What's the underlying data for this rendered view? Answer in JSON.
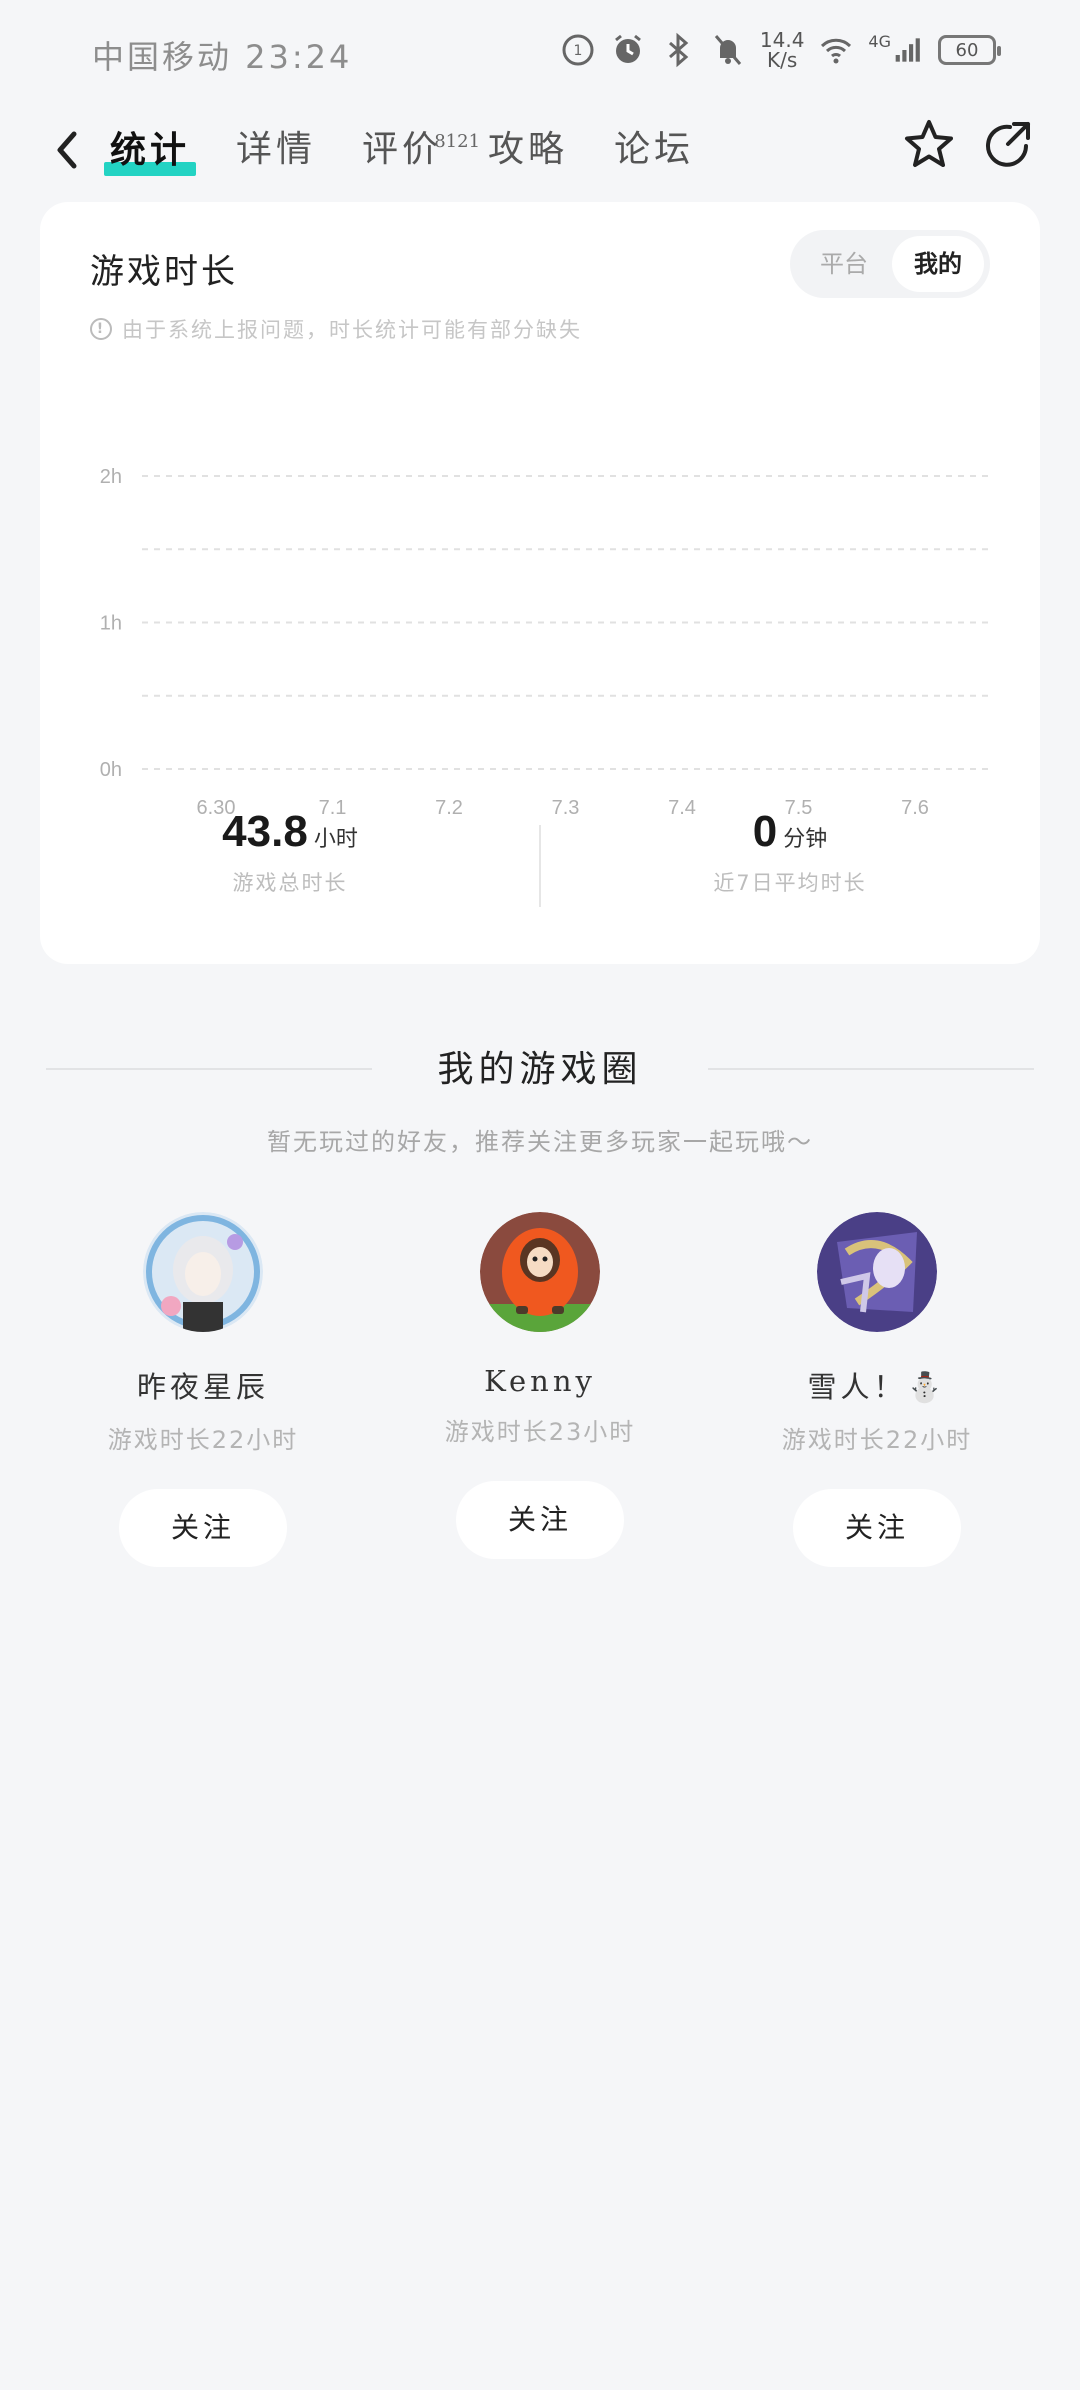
{
  "status_bar": {
    "carrier_time": "中国移动 23:24",
    "net_speed_value": "14.4",
    "net_speed_unit": "K/s",
    "network": "4G",
    "battery": "60"
  },
  "nav": {
    "tabs": [
      {
        "label": "统计",
        "active": true
      },
      {
        "label": "详情"
      },
      {
        "label": "评价",
        "badge": "8121"
      },
      {
        "label": "攻略"
      },
      {
        "label": "论坛"
      }
    ]
  },
  "playtime_card": {
    "title": "游戏时长",
    "toggle": {
      "options": [
        "平台",
        "我的"
      ],
      "selected": "我的"
    },
    "notice": "由于系统上报问题，时长统计可能有部分缺失",
    "total": {
      "value": "43.8",
      "unit": "小时",
      "label": "游戏总时长"
    },
    "average": {
      "value": "0",
      "unit": "分钟",
      "label": "近7日平均时长"
    }
  },
  "chart_data": {
    "type": "bar",
    "categories": [
      "6.30",
      "7.1",
      "7.2",
      "7.3",
      "7.4",
      "7.5",
      "7.6"
    ],
    "values": [
      0,
      0,
      0,
      0,
      0,
      0,
      0
    ],
    "y_ticks": [
      "2h",
      "1h",
      "0h"
    ],
    "ylim": [
      0,
      2
    ],
    "grid": true
  },
  "game_circle": {
    "title": "我的游戏圈",
    "subtitle": "暂无玩过的好友，推荐关注更多玩家一起玩哦～",
    "friends": [
      {
        "name": "昨夜星辰",
        "playtime": "游戏时长22小时",
        "follow_label": "关注"
      },
      {
        "name": "Kenny",
        "playtime": "游戏时长23小时",
        "follow_label": "关注"
      },
      {
        "name": "雪人！⛄",
        "playtime": "游戏时长22小时",
        "follow_label": "关注"
      }
    ]
  },
  "colors": {
    "accent": "#23d3c3",
    "background": "#f5f6f8"
  }
}
